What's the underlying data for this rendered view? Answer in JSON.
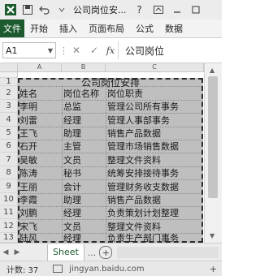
{
  "window": {
    "title": "公司岗位安..."
  },
  "ribbon": {
    "tabs": [
      "文件",
      "开始",
      "插入",
      "页面布局",
      "公式",
      "数据"
    ]
  },
  "formula_bar": {
    "name_box": "A1",
    "value": "公司岗位"
  },
  "grid": {
    "columns": [
      "A",
      "B",
      "C"
    ],
    "rows": [
      "1",
      "2",
      "3",
      "4",
      "5",
      "6",
      "7",
      "8",
      "9",
      "10",
      "11",
      "12",
      "13"
    ],
    "title": "公司岗位安排",
    "headers": [
      "姓名",
      "岗位名称",
      "岗位职责"
    ],
    "records": [
      [
        "李明",
        "总监",
        "管理公司所有事务"
      ],
      [
        "刘雷",
        "经理",
        "管理人事部事务"
      ],
      [
        "王飞",
        "助理",
        "销售产品数据"
      ],
      [
        "石开",
        "主管",
        "管理市场销售数据"
      ],
      [
        "吴敏",
        "文员",
        "整理文件资料"
      ],
      [
        "陈涛",
        "秘书",
        "统筹安排接待事务"
      ],
      [
        "王丽",
        "会计",
        "管理财务收支数据"
      ],
      [
        "李霞",
        "助理",
        "销售产品数据"
      ],
      [
        "刘鹏",
        "经理",
        "负责策划计划整理"
      ],
      [
        "宋飞",
        "文员",
        "整理文件资料"
      ],
      [
        "陆风",
        "经理",
        "负责生产部门事务"
      ]
    ]
  },
  "sheet_tabs": {
    "active": "Sheet",
    "more": "...",
    "add": "+"
  },
  "status": {
    "count": "计数: 37",
    "watermark": "jingyan.baidu.com"
  },
  "colors": {
    "file_tab": "#1d5b2f",
    "selection": "#bfbfbf"
  }
}
